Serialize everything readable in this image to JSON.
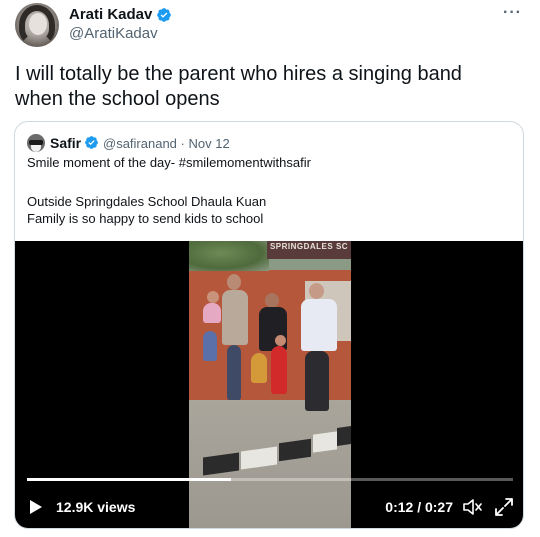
{
  "author": {
    "name": "Arati Kadav",
    "handle": "@AratiKadav"
  },
  "menu": {
    "more_label": "···"
  },
  "tweet": {
    "lines": [
      "I will totally be the parent who hires a singing band",
      "when the school opens"
    ]
  },
  "quote": {
    "name": "Safir",
    "handle": "@safiranand",
    "separator": "·",
    "date": "Nov 12",
    "lines": [
      "Smile moment of the day- #smilemomentwithsafir",
      "Outside Springdales School Dhaula Kuan",
      "Family is so happy to send kids to school"
    ]
  },
  "video": {
    "sign_text": "SPRINGDALES SC",
    "views": "12.9K views",
    "time": "0:12 / 0:27",
    "progress": 0.42
  },
  "colors": {
    "verified": "#1d9bf0",
    "secondary_text": "#536471",
    "border": "#cfd9de"
  },
  "icons": {
    "verified": "verified-badge-icon",
    "play": "play-icon",
    "mute": "volume-muted-icon",
    "fullscreen": "fullscreen-icon",
    "more": "more-dots-icon"
  }
}
